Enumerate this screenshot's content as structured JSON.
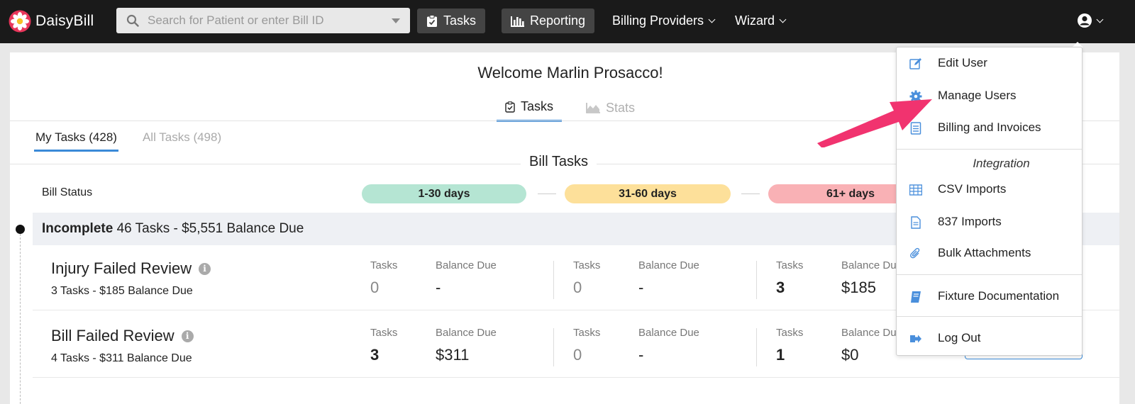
{
  "brand": {
    "name": "DaisyBill"
  },
  "search": {
    "placeholder": "Search for Patient or enter Bill ID"
  },
  "nav": {
    "tasks_label": "Tasks",
    "reporting_label": "Reporting",
    "billing_providers_label": "Billing Providers",
    "wizard_label": "Wizard"
  },
  "welcome": "Welcome Marlin Prosacco!",
  "view_tabs": {
    "tasks": "Tasks",
    "stats": "Stats"
  },
  "sub_tabs": {
    "my_tasks": "My Tasks (428)",
    "all_tasks": "All Tasks (498)"
  },
  "bill_tasks": {
    "title": "Bill Tasks",
    "status_label": "Bill Status",
    "buckets": [
      {
        "label": "1-30 days",
        "color": "#b5e5d3"
      },
      {
        "label": "31-60 days",
        "color": "#fde09a"
      },
      {
        "label": "61+ days",
        "color": "#f9b1b5"
      }
    ]
  },
  "group": {
    "name": "Incomplete",
    "summary": "46 Tasks - $5,551 Balance Due"
  },
  "column_labels": {
    "tasks": "Tasks",
    "balance_due": "Balance Due",
    "balance_due_truncated": "Balance Du"
  },
  "rows": [
    {
      "title": "Injury Failed Review",
      "subtitle": "3 Tasks - $185 Balance Due",
      "b1": {
        "tasks": "0",
        "balance": "-"
      },
      "b2": {
        "tasks": "0",
        "balance": "-"
      },
      "b3": {
        "tasks": "3",
        "balance": "$185"
      }
    },
    {
      "title": "Bill Failed Review",
      "subtitle": "4 Tasks - $311 Balance Due",
      "b1": {
        "tasks": "3",
        "balance": "$311"
      },
      "b2": {
        "tasks": "0",
        "balance": "-"
      },
      "b3": {
        "tasks": "1",
        "balance": "$0"
      }
    }
  ],
  "user_menu": {
    "items": [
      {
        "label": "Edit User",
        "icon": "edit-icon"
      },
      {
        "label": "Manage Users",
        "icon": "gear-icon"
      },
      {
        "label": "Billing and Invoices",
        "icon": "invoice-icon"
      },
      {
        "label": "CSV Imports",
        "icon": "grid-icon"
      },
      {
        "label": "837 Imports",
        "icon": "document-icon"
      },
      {
        "label": "Bulk Attachments",
        "icon": "paperclip-icon"
      },
      {
        "label": "Fixture Documentation",
        "icon": "book-icon"
      },
      {
        "label": "Log Out",
        "icon": "logout-icon"
      }
    ],
    "integration_heading": "Integration"
  },
  "colors": {
    "accent": "#3a8ad8",
    "nav_bg": "#1a1a1a",
    "arrow": "#f1336f",
    "icon_blue": "#4a8fdc"
  }
}
